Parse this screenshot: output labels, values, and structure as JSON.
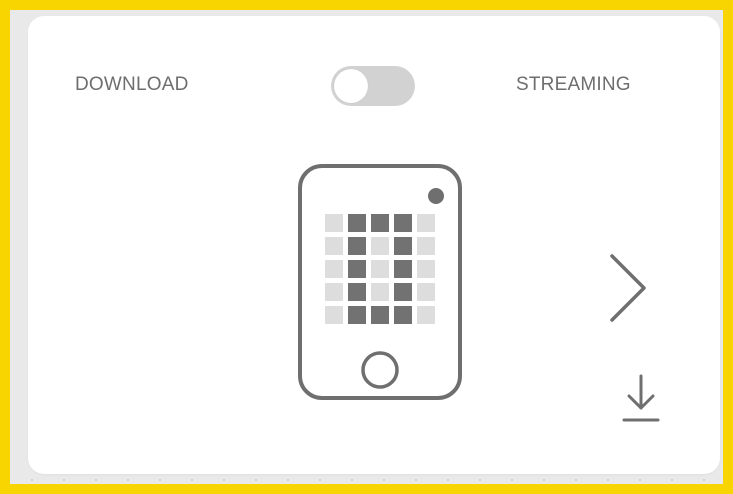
{
  "mode_switch": {
    "left_label": "DOWNLOAD",
    "right_label": "STREAMING",
    "state": "off"
  },
  "device": {
    "icon": "microbit-device-icon",
    "led_grid": [
      [
        0,
        1,
        1,
        1,
        0
      ],
      [
        0,
        1,
        0,
        1,
        0
      ],
      [
        0,
        1,
        0,
        1,
        0
      ],
      [
        0,
        1,
        0,
        1,
        0
      ],
      [
        0,
        1,
        1,
        1,
        0
      ]
    ]
  },
  "icons": {
    "next": "chevron-right-icon",
    "download": "download-icon"
  },
  "colors": {
    "frame": "#f8d500",
    "card": "#ffffff",
    "icon_stroke": "#6f6f6f",
    "led_on": "#727272",
    "led_off": "#dddddd",
    "label_text": "#6e6e6e"
  }
}
